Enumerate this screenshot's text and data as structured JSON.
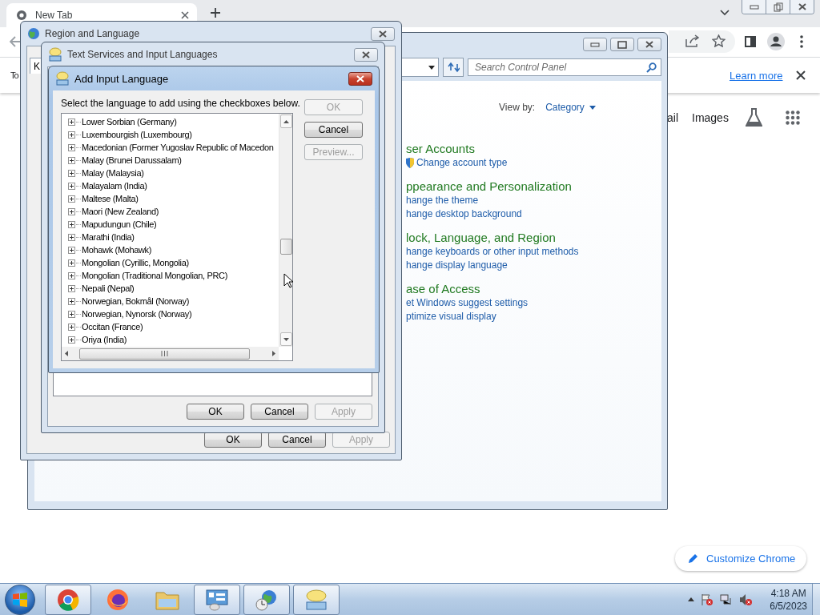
{
  "browser": {
    "tab": {
      "title": "New Tab"
    },
    "infobar": {
      "text": "To",
      "link": "Learn more"
    },
    "shortcuts": [
      "ail",
      "Images"
    ],
    "customize_button": "Customize Chrome"
  },
  "control_panel": {
    "search": {
      "placeholder": "Search Control Panel"
    },
    "view_by": {
      "label": "View by:",
      "value": "Category"
    },
    "categories": [
      {
        "title": "ser Accounts",
        "links": [
          {
            "text": "Change account type",
            "kind": "shield"
          }
        ]
      },
      {
        "title": "ppearance and Personalization",
        "links": [
          {
            "text": "hange the theme",
            "kind": "plain"
          },
          {
            "text": "hange desktop background",
            "kind": "plain"
          }
        ]
      },
      {
        "title": "lock, Language, and Region",
        "links": [
          {
            "text": "hange keyboards or other input methods",
            "kind": "plain"
          },
          {
            "text": "hange display language",
            "kind": "plain"
          }
        ]
      },
      {
        "title": "ase of Access",
        "links": [
          {
            "text": "et Windows suggest settings",
            "kind": "plain"
          },
          {
            "text": "ptimize visual display",
            "kind": "plain"
          }
        ]
      }
    ]
  },
  "region_dialog": {
    "title": "Region and Language",
    "tab": "K",
    "buttons": [
      {
        "label": "OK",
        "disabled": false
      },
      {
        "label": "Cancel",
        "disabled": false
      },
      {
        "label": "Apply",
        "disabled": true
      }
    ]
  },
  "text_services_dialog": {
    "title": "Text Services and Input Languages",
    "buttons": [
      {
        "label": "OK",
        "disabled": false
      },
      {
        "label": "Cancel",
        "disabled": false
      },
      {
        "label": "Apply",
        "disabled": true
      }
    ]
  },
  "add_language_dialog": {
    "title": "Add Input Language",
    "instruction": "Select the language to add using the checkboxes below.",
    "languages": [
      {
        "label": "Lower Sorbian (Germany)",
        "expanded": false
      },
      {
        "label": "Luxembourgish (Luxembourg)",
        "expanded": false
      },
      {
        "label": "Macedonian (Former Yugoslav Republic of Macedon",
        "expanded": false
      },
      {
        "label": "Malay (Brunei Darussalam)",
        "expanded": false
      },
      {
        "label": "Malay (Malaysia)",
        "expanded": false
      },
      {
        "label": "Malayalam (India)",
        "expanded": false
      },
      {
        "label": "Maltese (Malta)",
        "expanded": false
      },
      {
        "label": "Maori (New Zealand)",
        "expanded": false
      },
      {
        "label": "Mapudungun (Chile)",
        "expanded": false
      },
      {
        "label": "Marathi (India)",
        "expanded": false
      },
      {
        "label": "Mohawk (Mohawk)",
        "expanded": false
      },
      {
        "label": "Mongolian (Cyrillic, Mongolia)",
        "expanded": false
      },
      {
        "label": "Mongolian (Traditional Mongolian, PRC)",
        "expanded": false
      },
      {
        "label": "Nepali (Nepal)",
        "expanded": false
      },
      {
        "label": "Norwegian, Bokmål (Norway)",
        "expanded": false
      },
      {
        "label": "Norwegian, Nynorsk (Norway)",
        "expanded": false
      },
      {
        "label": "Occitan (France)",
        "expanded": false
      },
      {
        "label": "Oriya (India)",
        "expanded": false
      }
    ],
    "buttons": [
      {
        "label": "OK",
        "disabled": true
      },
      {
        "label": "Cancel",
        "disabled": false
      },
      {
        "label": "Preview...",
        "disabled": true
      }
    ]
  },
  "taskbar": {
    "apps": [
      {
        "kind": "chrome",
        "running": true
      },
      {
        "kind": "firefox",
        "running": false
      },
      {
        "kind": "explorer",
        "running": false
      },
      {
        "kind": "control_panel",
        "running": true
      },
      {
        "kind": "region",
        "running": true
      },
      {
        "kind": "text_services",
        "running": true
      }
    ],
    "clock": {
      "time": "4:18 AM",
      "date": "6/5/2023"
    }
  }
}
